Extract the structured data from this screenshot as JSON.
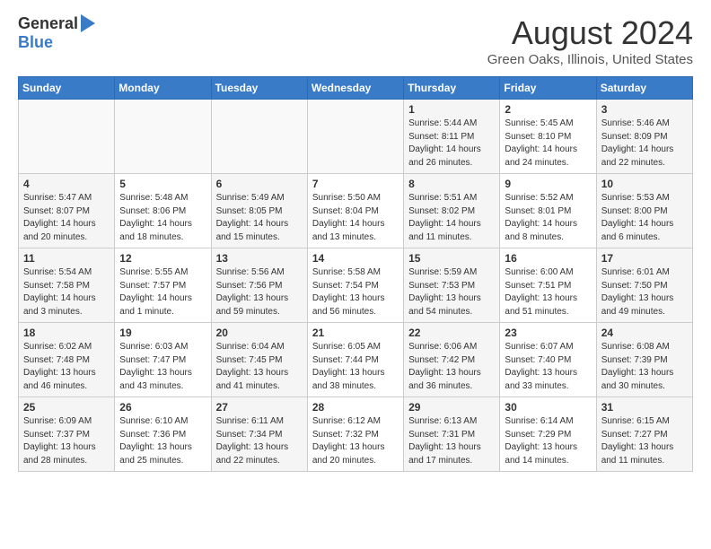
{
  "header": {
    "logo_general": "General",
    "logo_blue": "Blue",
    "month": "August 2024",
    "location": "Green Oaks, Illinois, United States"
  },
  "weekdays": [
    "Sunday",
    "Monday",
    "Tuesday",
    "Wednesday",
    "Thursday",
    "Friday",
    "Saturday"
  ],
  "weeks": [
    [
      {
        "day": "",
        "info": ""
      },
      {
        "day": "",
        "info": ""
      },
      {
        "day": "",
        "info": ""
      },
      {
        "day": "",
        "info": ""
      },
      {
        "day": "1",
        "info": "Sunrise: 5:44 AM\nSunset: 8:11 PM\nDaylight: 14 hours\nand 26 minutes."
      },
      {
        "day": "2",
        "info": "Sunrise: 5:45 AM\nSunset: 8:10 PM\nDaylight: 14 hours\nand 24 minutes."
      },
      {
        "day": "3",
        "info": "Sunrise: 5:46 AM\nSunset: 8:09 PM\nDaylight: 14 hours\nand 22 minutes."
      }
    ],
    [
      {
        "day": "4",
        "info": "Sunrise: 5:47 AM\nSunset: 8:07 PM\nDaylight: 14 hours\nand 20 minutes."
      },
      {
        "day": "5",
        "info": "Sunrise: 5:48 AM\nSunset: 8:06 PM\nDaylight: 14 hours\nand 18 minutes."
      },
      {
        "day": "6",
        "info": "Sunrise: 5:49 AM\nSunset: 8:05 PM\nDaylight: 14 hours\nand 15 minutes."
      },
      {
        "day": "7",
        "info": "Sunrise: 5:50 AM\nSunset: 8:04 PM\nDaylight: 14 hours\nand 13 minutes."
      },
      {
        "day": "8",
        "info": "Sunrise: 5:51 AM\nSunset: 8:02 PM\nDaylight: 14 hours\nand 11 minutes."
      },
      {
        "day": "9",
        "info": "Sunrise: 5:52 AM\nSunset: 8:01 PM\nDaylight: 14 hours\nand 8 minutes."
      },
      {
        "day": "10",
        "info": "Sunrise: 5:53 AM\nSunset: 8:00 PM\nDaylight: 14 hours\nand 6 minutes."
      }
    ],
    [
      {
        "day": "11",
        "info": "Sunrise: 5:54 AM\nSunset: 7:58 PM\nDaylight: 14 hours\nand 3 minutes."
      },
      {
        "day": "12",
        "info": "Sunrise: 5:55 AM\nSunset: 7:57 PM\nDaylight: 14 hours\nand 1 minute."
      },
      {
        "day": "13",
        "info": "Sunrise: 5:56 AM\nSunset: 7:56 PM\nDaylight: 13 hours\nand 59 minutes."
      },
      {
        "day": "14",
        "info": "Sunrise: 5:58 AM\nSunset: 7:54 PM\nDaylight: 13 hours\nand 56 minutes."
      },
      {
        "day": "15",
        "info": "Sunrise: 5:59 AM\nSunset: 7:53 PM\nDaylight: 13 hours\nand 54 minutes."
      },
      {
        "day": "16",
        "info": "Sunrise: 6:00 AM\nSunset: 7:51 PM\nDaylight: 13 hours\nand 51 minutes."
      },
      {
        "day": "17",
        "info": "Sunrise: 6:01 AM\nSunset: 7:50 PM\nDaylight: 13 hours\nand 49 minutes."
      }
    ],
    [
      {
        "day": "18",
        "info": "Sunrise: 6:02 AM\nSunset: 7:48 PM\nDaylight: 13 hours\nand 46 minutes."
      },
      {
        "day": "19",
        "info": "Sunrise: 6:03 AM\nSunset: 7:47 PM\nDaylight: 13 hours\nand 43 minutes."
      },
      {
        "day": "20",
        "info": "Sunrise: 6:04 AM\nSunset: 7:45 PM\nDaylight: 13 hours\nand 41 minutes."
      },
      {
        "day": "21",
        "info": "Sunrise: 6:05 AM\nSunset: 7:44 PM\nDaylight: 13 hours\nand 38 minutes."
      },
      {
        "day": "22",
        "info": "Sunrise: 6:06 AM\nSunset: 7:42 PM\nDaylight: 13 hours\nand 36 minutes."
      },
      {
        "day": "23",
        "info": "Sunrise: 6:07 AM\nSunset: 7:40 PM\nDaylight: 13 hours\nand 33 minutes."
      },
      {
        "day": "24",
        "info": "Sunrise: 6:08 AM\nSunset: 7:39 PM\nDaylight: 13 hours\nand 30 minutes."
      }
    ],
    [
      {
        "day": "25",
        "info": "Sunrise: 6:09 AM\nSunset: 7:37 PM\nDaylight: 13 hours\nand 28 minutes."
      },
      {
        "day": "26",
        "info": "Sunrise: 6:10 AM\nSunset: 7:36 PM\nDaylight: 13 hours\nand 25 minutes."
      },
      {
        "day": "27",
        "info": "Sunrise: 6:11 AM\nSunset: 7:34 PM\nDaylight: 13 hours\nand 22 minutes."
      },
      {
        "day": "28",
        "info": "Sunrise: 6:12 AM\nSunset: 7:32 PM\nDaylight: 13 hours\nand 20 minutes."
      },
      {
        "day": "29",
        "info": "Sunrise: 6:13 AM\nSunset: 7:31 PM\nDaylight: 13 hours\nand 17 minutes."
      },
      {
        "day": "30",
        "info": "Sunrise: 6:14 AM\nSunset: 7:29 PM\nDaylight: 13 hours\nand 14 minutes."
      },
      {
        "day": "31",
        "info": "Sunrise: 6:15 AM\nSunset: 7:27 PM\nDaylight: 13 hours\nand 11 minutes."
      }
    ]
  ]
}
